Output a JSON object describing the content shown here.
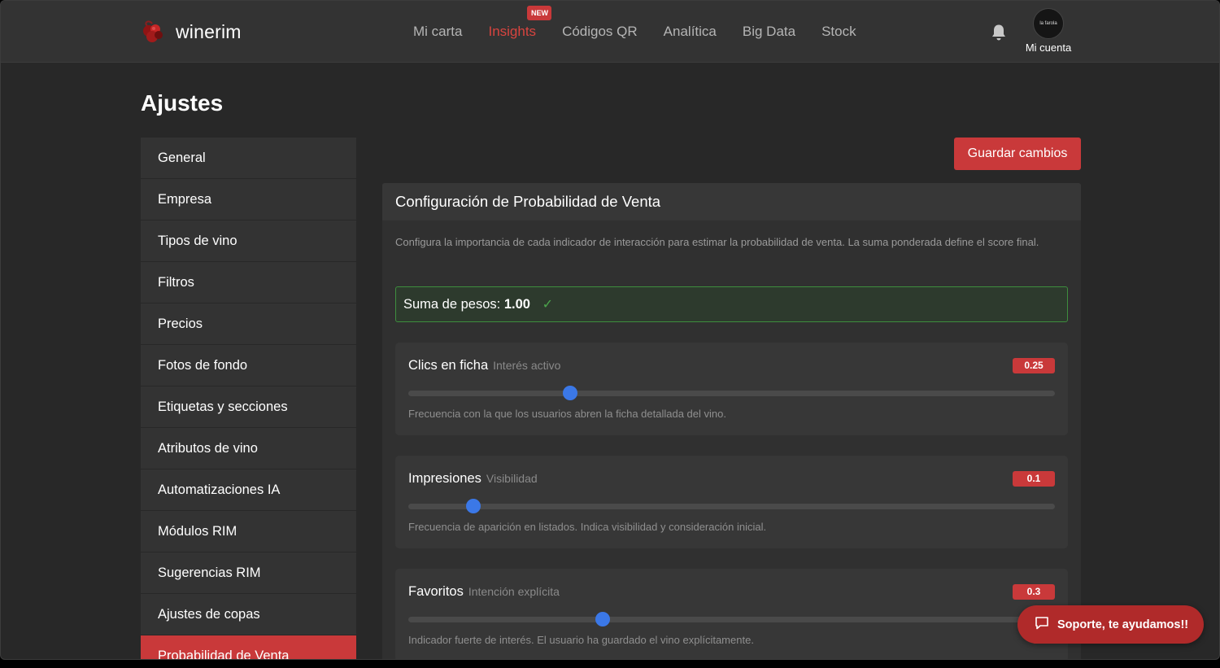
{
  "app": {
    "name": "winerim"
  },
  "nav": {
    "items": [
      {
        "label": "Mi carta"
      },
      {
        "label": "Insights",
        "active": true,
        "badge": "NEW"
      },
      {
        "label": "Códigos QR"
      },
      {
        "label": "Analítica"
      },
      {
        "label": "Big Data"
      },
      {
        "label": "Stock"
      }
    ],
    "account_label": "Mi cuenta",
    "avatar_text": "la farola",
    "bell_icon": "bell-icon"
  },
  "page": {
    "title": "Ajustes"
  },
  "sidebar": {
    "items": [
      {
        "label": "General"
      },
      {
        "label": "Empresa"
      },
      {
        "label": "Tipos de vino"
      },
      {
        "label": "Filtros"
      },
      {
        "label": "Precios"
      },
      {
        "label": "Fotos de fondo"
      },
      {
        "label": "Etiquetas y secciones"
      },
      {
        "label": "Atributos de vino"
      },
      {
        "label": "Automatizaciones IA"
      },
      {
        "label": "Módulos RIM"
      },
      {
        "label": "Sugerencias RIM"
      },
      {
        "label": "Ajustes de copas"
      },
      {
        "label": "Probabilidad de Venta",
        "active": true
      }
    ]
  },
  "toolbar": {
    "save_label": "Guardar cambios"
  },
  "card": {
    "title": "Configuración de Probabilidad de Venta",
    "description": "Configura la importancia de cada indicador de interacción para estimar la probabilidad de venta. La suma ponderada define el score final.",
    "sum_label": "Suma de pesos:",
    "sum_value": "1.00",
    "sum_status_icon": "check-icon"
  },
  "weights": [
    {
      "title": "Clics en ficha",
      "subtitle": "Interés activo",
      "value": "0.25",
      "slider_fraction": 0.25,
      "description": "Frecuencia con la que los usuarios abren la ficha detallada del vino."
    },
    {
      "title": "Impresiones",
      "subtitle": "Visibilidad",
      "value": "0.1",
      "slider_fraction": 0.1,
      "description": "Frecuencia de aparición en listados. Indica visibilidad y consideración inicial."
    },
    {
      "title": "Favoritos",
      "subtitle": "Intención explícita",
      "value": "0.3",
      "slider_fraction": 0.3,
      "description": "Indicador fuerte de interés. El usuario ha guardado el vino explícitamente."
    }
  ],
  "support": {
    "label": "Soporte, te ayudamos!!",
    "icon": "chat-icon"
  },
  "colors": {
    "accent": "#c9393a",
    "slider": "#3b78e7",
    "success": "#4ca64c",
    "background": "#282828"
  }
}
